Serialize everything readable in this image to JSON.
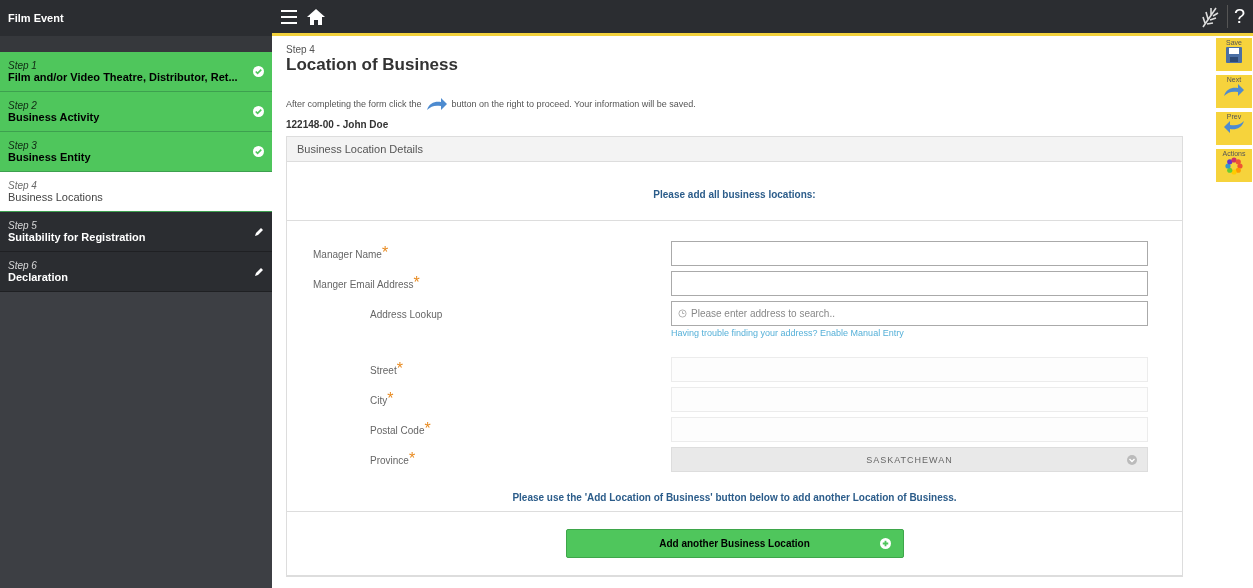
{
  "sidebar": {
    "title": "Film Event",
    "steps": [
      {
        "step": "Step 1",
        "label": "Film and/or Video Theatre, Distributor, Ret...",
        "done": true,
        "selected": false
      },
      {
        "step": "Step 2",
        "label": "Business Activity",
        "done": true,
        "selected": false
      },
      {
        "step": "Step 3",
        "label": "Business Entity",
        "done": true,
        "selected": false
      },
      {
        "step": "Step 4",
        "label": "Business Locations",
        "done": false,
        "selected": true
      },
      {
        "step": "Step 5",
        "label": "Suitability for Registration",
        "done": false,
        "selected": false
      },
      {
        "step": "Step 6",
        "label": "Declaration",
        "done": false,
        "selected": false
      }
    ]
  },
  "topbar": {
    "help": "?"
  },
  "actions": [
    {
      "label": "Save",
      "kind": "save"
    },
    {
      "label": "Next",
      "kind": "next"
    },
    {
      "label": "Prev",
      "kind": "prev"
    },
    {
      "label": "Actions",
      "kind": "actions"
    }
  ],
  "page": {
    "step": "Step 4",
    "title": "Location of Business",
    "instruction_before": "After completing the form click the",
    "instruction_after": "button on the right to proceed. Your information will be saved.",
    "applicant": "122148-00 - John Doe"
  },
  "panel": {
    "title": "Business Location Details",
    "prompt": "Please add all business locations:",
    "fields": [
      {
        "label": "Manager Name",
        "required_mark": "*",
        "kind": "text",
        "disabled": false
      },
      {
        "label": "Manger Email Address",
        "required_mark": "*",
        "kind": "text",
        "disabled": false
      }
    ],
    "address_fields": [
      {
        "label": "Address Lookup",
        "kind": "lookup",
        "disabled": false,
        "placeholder": "Please enter address to search..",
        "link": "Having trouble finding your address? Enable Manual Entry"
      },
      {
        "label": "Street",
        "required_mark": "*",
        "kind": "text",
        "disabled": true
      },
      {
        "label": "City",
        "required_mark": "*",
        "kind": "text",
        "disabled": true
      },
      {
        "label": "Postal Code",
        "required_mark": "*",
        "kind": "text",
        "disabled": true
      },
      {
        "label": "Province",
        "required_mark": "*",
        "kind": "select",
        "disabled": true,
        "value": "SASKATCHEWAN"
      }
    ],
    "note": "Please use the 'Add Location of Business' button below to add another Location of Business.",
    "add_button": "Add another Business Location"
  }
}
